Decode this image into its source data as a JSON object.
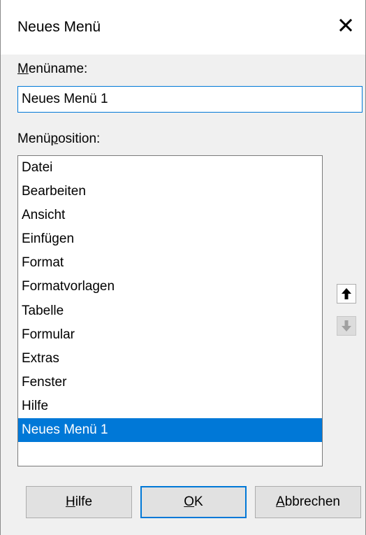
{
  "dialog": {
    "title": "Neues Menü"
  },
  "menu_name": {
    "label_mnemonic": "M",
    "label_rest": "enüname:",
    "value": "Neues Menü 1"
  },
  "menu_position": {
    "label_pre": "Menü",
    "label_mnemonic": "p",
    "label_post": "osition:",
    "items": [
      "Datei",
      "Bearbeiten",
      "Ansicht",
      "Einfügen",
      "Format",
      "Formatvorlagen",
      "Tabelle",
      "Formular",
      "Extras",
      "Fenster",
      "Hilfe",
      "Neues Menü 1"
    ],
    "selected": "Neues Menü 1"
  },
  "buttons": {
    "help_mnemonic": "H",
    "help_rest": "ilfe",
    "ok_mnemonic": "O",
    "ok_rest": "K",
    "cancel_mnemonic": "A",
    "cancel_rest": "bbrechen"
  },
  "colors": {
    "accent": "#0078d7",
    "dialog_bg": "#f0f0f0"
  },
  "icons": {
    "close": "close-icon",
    "move_up": "arrow-up-icon",
    "move_down": "arrow-down-icon"
  }
}
